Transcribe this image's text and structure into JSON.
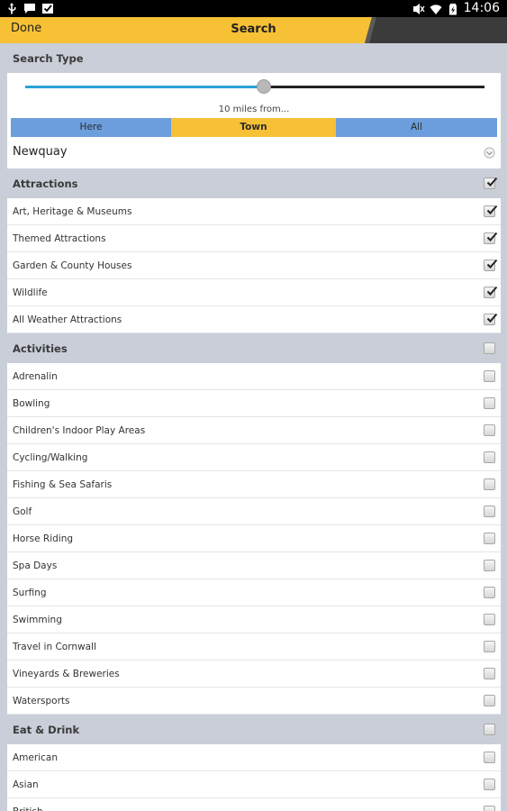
{
  "status_bar": {
    "time": "14:06"
  },
  "action_bar": {
    "done_label": "Done",
    "title": "Search"
  },
  "search_type": {
    "header": "Search Type",
    "slider_fraction": 0.52,
    "range_label": "10 miles from...",
    "segments": [
      {
        "label": "Here",
        "active": false
      },
      {
        "label": "Town",
        "active": true
      },
      {
        "label": "All",
        "active": false
      }
    ],
    "town_value": "Newquay"
  },
  "sections": [
    {
      "title": "Attractions",
      "checked": true,
      "items": [
        {
          "label": "Art, Heritage & Museums",
          "checked": true
        },
        {
          "label": "Themed Attractions",
          "checked": true
        },
        {
          "label": "Garden & County Houses",
          "checked": true
        },
        {
          "label": "Wildlife",
          "checked": true
        },
        {
          "label": "All Weather Attractions",
          "checked": true
        }
      ]
    },
    {
      "title": "Activities",
      "checked": false,
      "items": [
        {
          "label": "Adrenalin",
          "checked": false
        },
        {
          "label": "Bowling",
          "checked": false
        },
        {
          "label": "Children's Indoor Play Areas",
          "checked": false
        },
        {
          "label": "Cycling/Walking",
          "checked": false
        },
        {
          "label": "Fishing & Sea Safaris",
          "checked": false
        },
        {
          "label": "Golf",
          "checked": false
        },
        {
          "label": "Horse Riding",
          "checked": false
        },
        {
          "label": "Spa Days",
          "checked": false
        },
        {
          "label": "Surfing",
          "checked": false
        },
        {
          "label": "Swimming",
          "checked": false
        },
        {
          "label": "Travel in Cornwall",
          "checked": false
        },
        {
          "label": "Vineyards & Breweries",
          "checked": false
        },
        {
          "label": "Watersports",
          "checked": false
        }
      ]
    },
    {
      "title": "Eat & Drink",
      "checked": false,
      "items": [
        {
          "label": "American",
          "checked": false
        },
        {
          "label": "Asian",
          "checked": false
        },
        {
          "label": "British",
          "checked": false
        }
      ]
    }
  ],
  "colors": {
    "accent": "#f7c136",
    "segment": "#6c9ede",
    "slider": "#2aa1d8",
    "background": "#c9ced8"
  }
}
